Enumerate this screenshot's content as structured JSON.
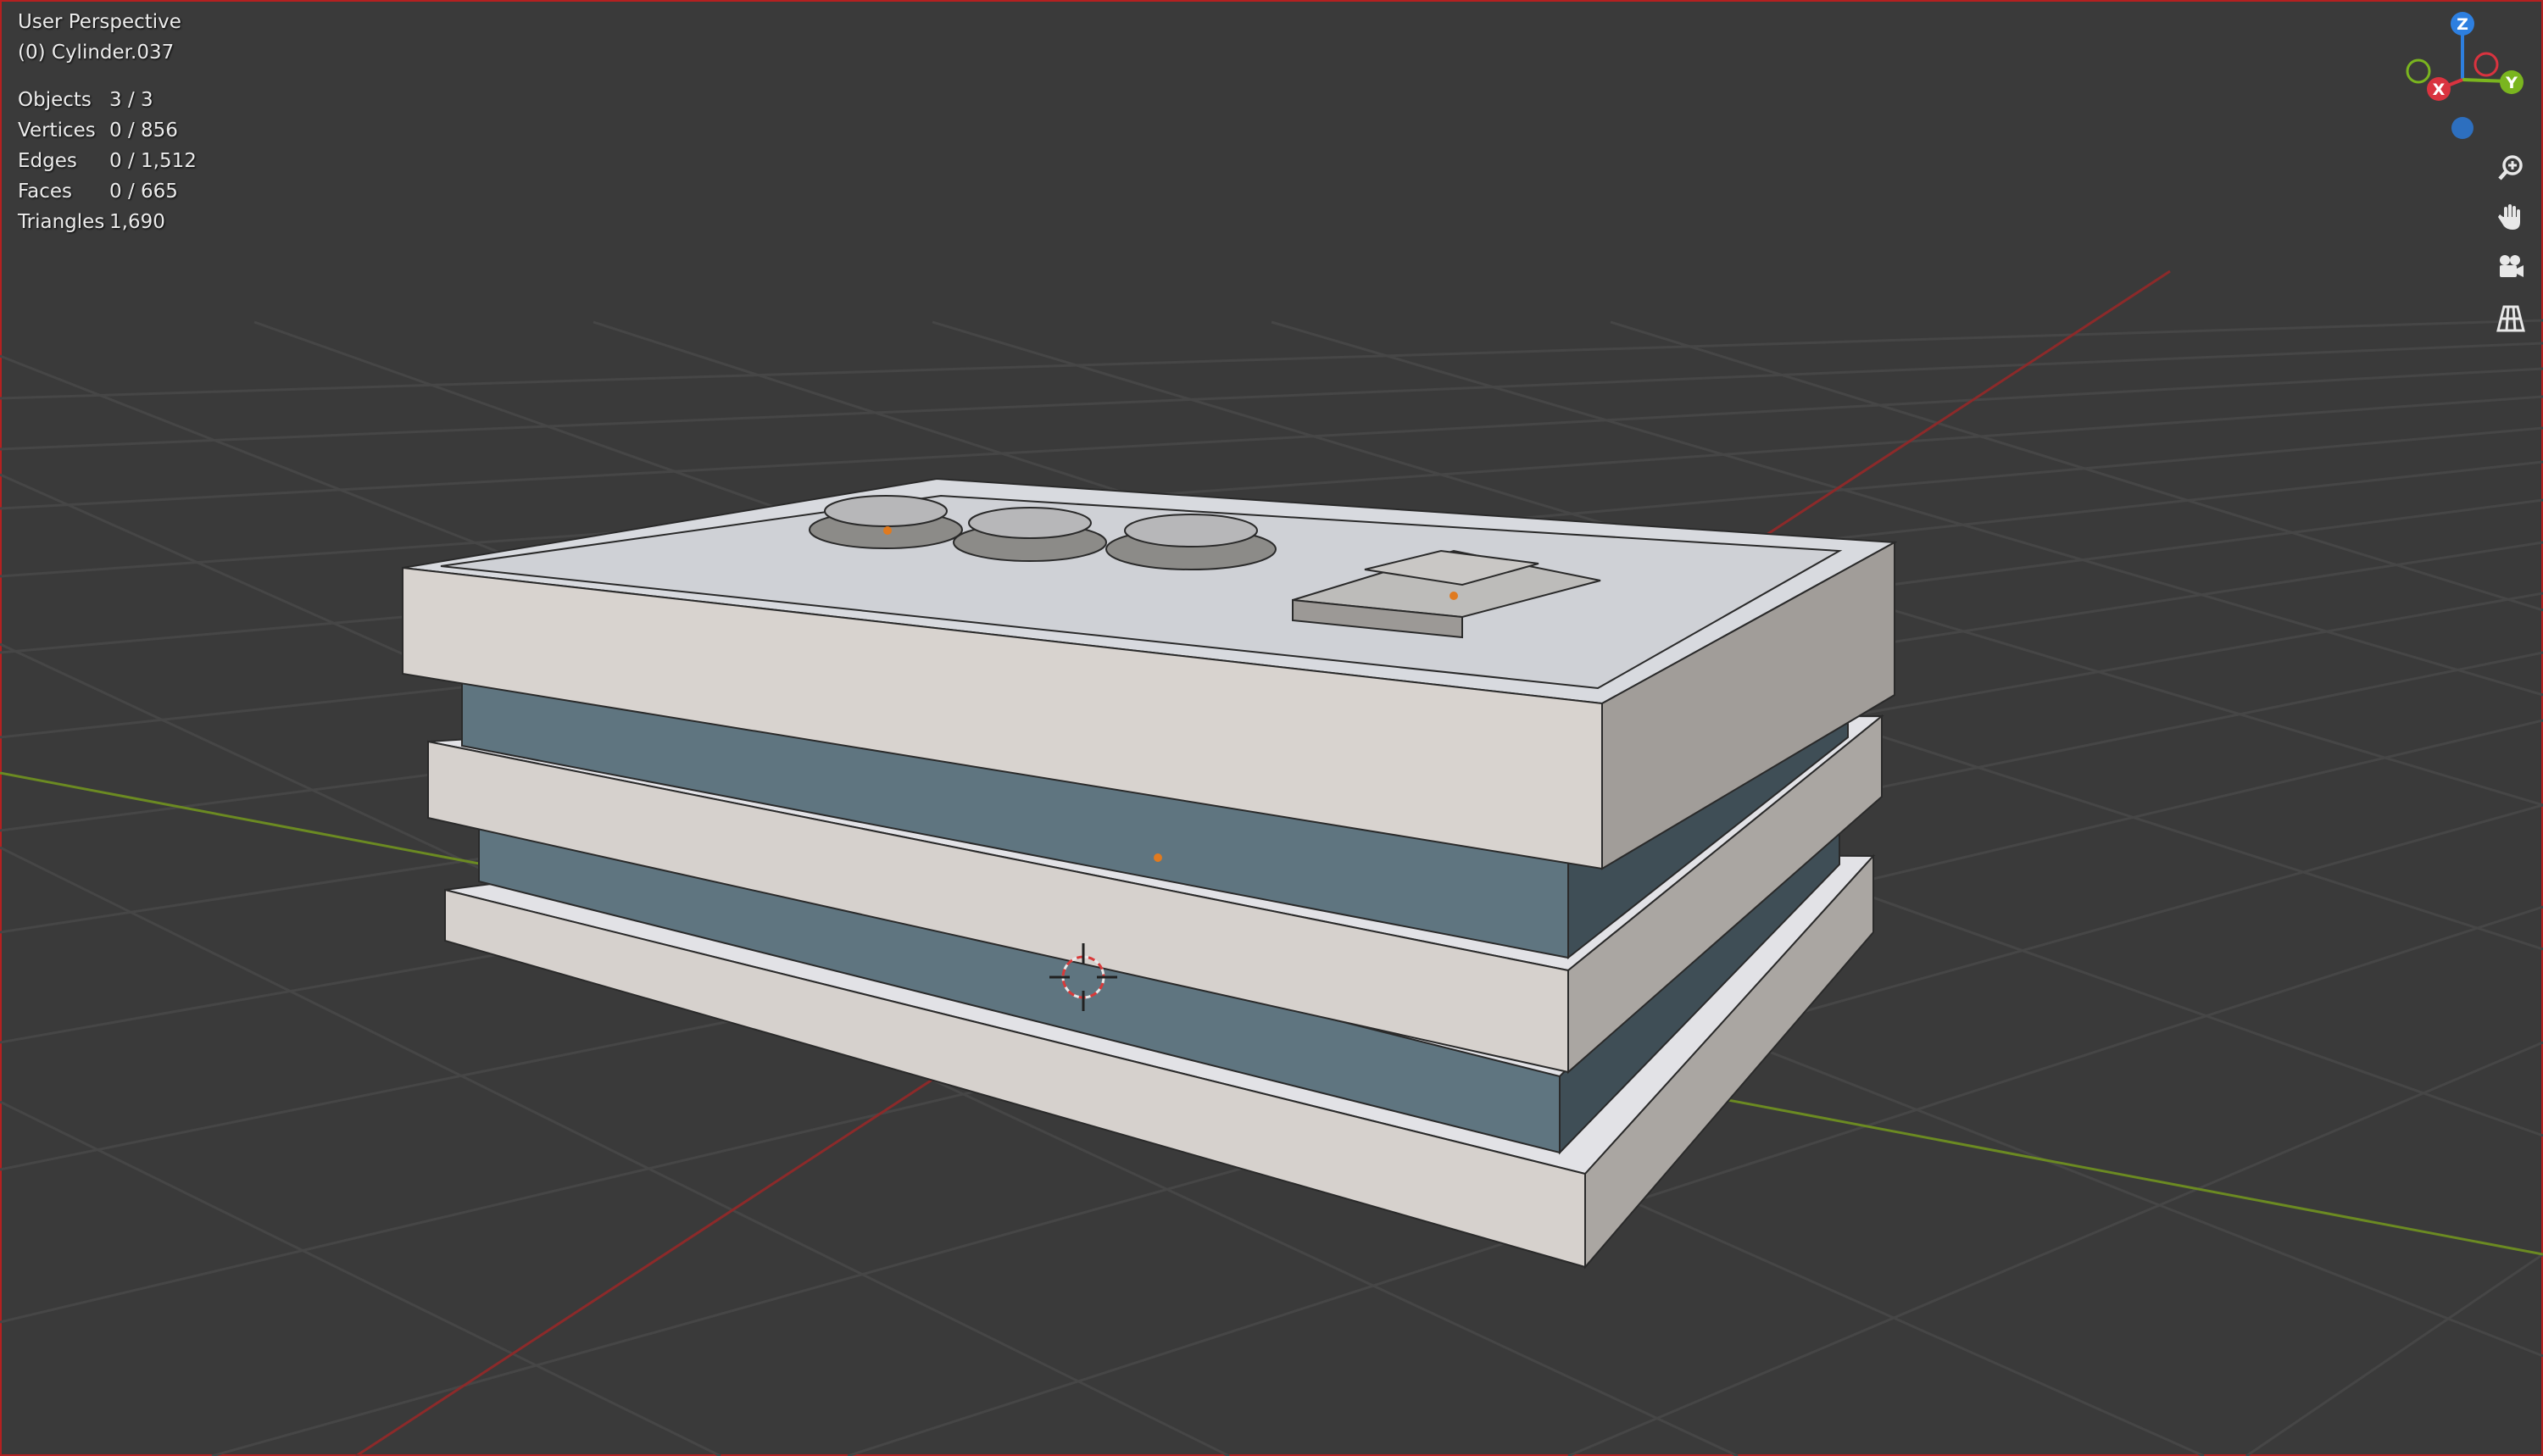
{
  "viewport": {
    "view_name": "User Perspective",
    "active_object": "(0) Cylinder.037"
  },
  "stats": [
    {
      "label": "Objects",
      "value": "3 / 3"
    },
    {
      "label": "Vertices",
      "value": "0 / 856"
    },
    {
      "label": "Edges",
      "value": "0 / 1,512"
    },
    {
      "label": "Faces",
      "value": "0 / 665"
    },
    {
      "label": "Triangles",
      "value": "1,690"
    }
  ],
  "gizmo": {
    "z_label": "Z",
    "x_label": "X",
    "y_label": "Y",
    "colors": {
      "x": "#d9333f",
      "y": "#7ab51f",
      "z": "#2d7fe0"
    }
  },
  "tools": [
    "zoom-icon",
    "hand-pan-icon",
    "camera-icon",
    "grid-icon"
  ],
  "colors": {
    "background": "#3a3a3a",
    "grid": "#454545",
    "x_axis": "#9a2a2a",
    "y_axis": "#6d8a1f",
    "model_light": "#d4d0cc",
    "model_blue": "#5f7580"
  }
}
